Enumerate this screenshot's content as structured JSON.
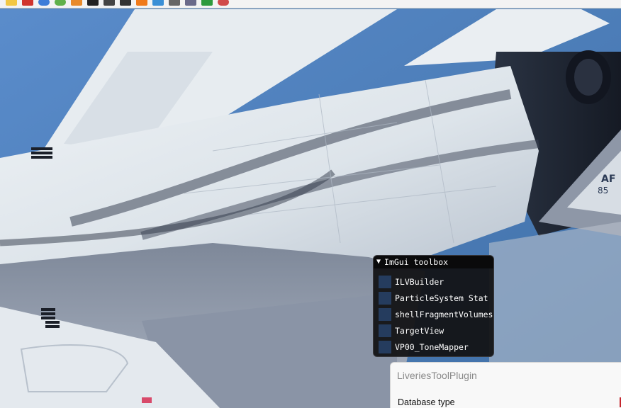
{
  "toolbar": {
    "icons": [
      "folder-open-icon",
      "ruby-icon",
      "globe-icon",
      "globe-green-icon",
      "image-icon",
      "cursor-icon",
      "save-icon",
      "image-frame-icon",
      "fire-icon",
      "atom-icon",
      "brush-icon",
      "grid-icon",
      "dots-grid-icon",
      "target-icon"
    ],
    "colors": [
      "#f2c744",
      "#d0352e",
      "#3d7dd8",
      "#5fb04a",
      "#e88a2a",
      "#222222",
      "#444444",
      "#333333",
      "#f07a1a",
      "#3a8fd6",
      "#666666",
      "#6a6a8a",
      "#2d9a3d",
      "#d04a4a"
    ]
  },
  "viewport": {
    "sky_color": "#4b7fb6",
    "tail_text_line1": "AF",
    "tail_text_line2": "85"
  },
  "imgui": {
    "title": "ImGui toolbox",
    "items": [
      {
        "label": "ILVBuilder",
        "checked": false
      },
      {
        "label": "ParticleSystem Stat",
        "checked": false
      },
      {
        "label": "shellFragmentVolumes",
        "checked": false
      },
      {
        "label": "TargetView",
        "checked": false
      },
      {
        "label": "VP00_ToneMapper",
        "checked": false
      }
    ]
  },
  "plugin": {
    "title": "LiveriesToolPlugin",
    "field_label": "Database type"
  }
}
